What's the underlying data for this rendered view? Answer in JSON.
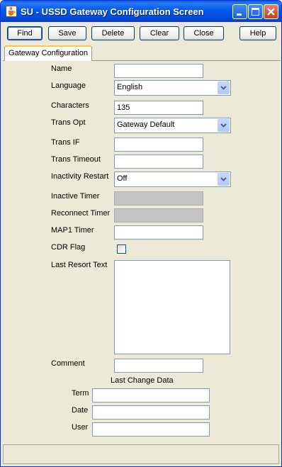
{
  "window": {
    "title": "SU - USSD Gateway Configuration Screen",
    "icon": "java-cup-icon",
    "controls": [
      "minimize-icon",
      "maximize-icon",
      "close-icon"
    ],
    "accent": "#0054e3"
  },
  "toolbar": {
    "find": "Find",
    "save": "Save",
    "delete": "Delete",
    "clear": "Clear",
    "close": "Close",
    "help": "Help"
  },
  "tabs": [
    {
      "label": "Gateway Configuration",
      "active": true
    }
  ],
  "form": {
    "name": {
      "label": "Name",
      "value": ""
    },
    "language": {
      "label": "Language",
      "value": "English"
    },
    "characters": {
      "label": "Characters",
      "value": "135"
    },
    "trans_opt": {
      "label": "Trans Opt",
      "value": "Gateway Default"
    },
    "trans_if": {
      "label": "Trans IF",
      "value": ""
    },
    "trans_timeout": {
      "label": "Trans Timeout",
      "value": ""
    },
    "inactivity_restart": {
      "label": "Inactivity Restart",
      "value": "Off"
    },
    "inactive_timer": {
      "label": "Inactive Timer",
      "value": "",
      "enabled": false
    },
    "reconnect_timer": {
      "label": "Reconnect Timer",
      "value": "",
      "enabled": false
    },
    "map1_timer": {
      "label": "MAP1 Timer",
      "value": ""
    },
    "cdr_flag": {
      "label": "CDR Flag",
      "checked": false
    },
    "last_resort_text": {
      "label": "Last Resort Text",
      "value": ""
    },
    "comment": {
      "label": "Comment",
      "value": ""
    }
  },
  "last_change": {
    "heading": "Last Change Data",
    "term": {
      "label": "Term",
      "value": ""
    },
    "date": {
      "label": "Date",
      "value": ""
    },
    "user": {
      "label": "User",
      "value": ""
    }
  },
  "status": {
    "text": ""
  }
}
